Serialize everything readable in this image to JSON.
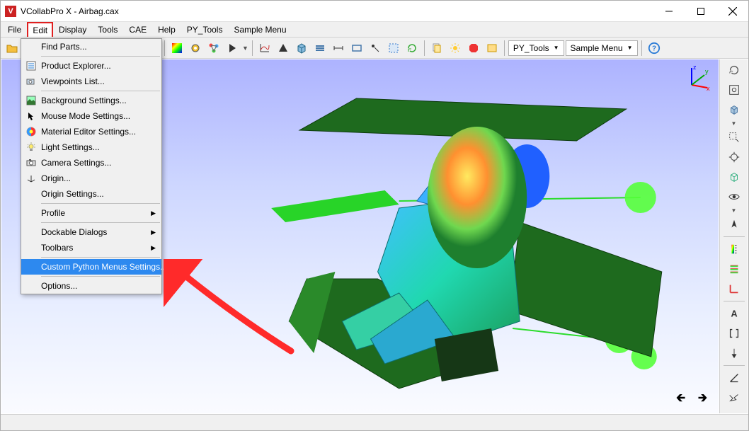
{
  "window": {
    "title": "VCollabPro X - Airbag.cax",
    "icon_letter": "V"
  },
  "menubar": [
    {
      "id": "file",
      "label": "File"
    },
    {
      "id": "edit",
      "label": "Edit",
      "active": true
    },
    {
      "id": "display",
      "label": "Display"
    },
    {
      "id": "tools",
      "label": "Tools"
    },
    {
      "id": "cae",
      "label": "CAE"
    },
    {
      "id": "help",
      "label": "Help"
    },
    {
      "id": "pytools",
      "label": "PY_Tools"
    },
    {
      "id": "sample",
      "label": "Sample Menu"
    }
  ],
  "toolbar_combos": {
    "pytools": "PY_Tools",
    "sample": "Sample Menu"
  },
  "dropdown": {
    "items": [
      {
        "label": "Find Parts...",
        "icon": ""
      },
      {
        "sep": true
      },
      {
        "label": "Product Explorer...",
        "icon": "tree"
      },
      {
        "label": "Viewpoints List...",
        "icon": "camera"
      },
      {
        "sep": true
      },
      {
        "label": "Background Settings...",
        "icon": "bg"
      },
      {
        "label": "Mouse Mode Settings...",
        "icon": "cursor"
      },
      {
        "label": "Material Editor Settings...",
        "icon": "colorwheel"
      },
      {
        "label": "Light Settings...",
        "icon": "bulb"
      },
      {
        "label": "Camera Settings...",
        "icon": "camera"
      },
      {
        "label": "Origin...",
        "icon": "origin"
      },
      {
        "label": "Origin Settings..."
      },
      {
        "sep": true
      },
      {
        "label": "Profile",
        "submenu": true
      },
      {
        "sep": true
      },
      {
        "label": "Dockable Dialogs",
        "submenu": true
      },
      {
        "label": "Toolbars",
        "submenu": true
      },
      {
        "sep": true
      },
      {
        "label": "Custom Python Menus Settings...",
        "highlight": true
      },
      {
        "sep": true
      },
      {
        "label": "Options..."
      }
    ]
  },
  "axes": {
    "x": "x",
    "y": "y",
    "z": "z"
  }
}
